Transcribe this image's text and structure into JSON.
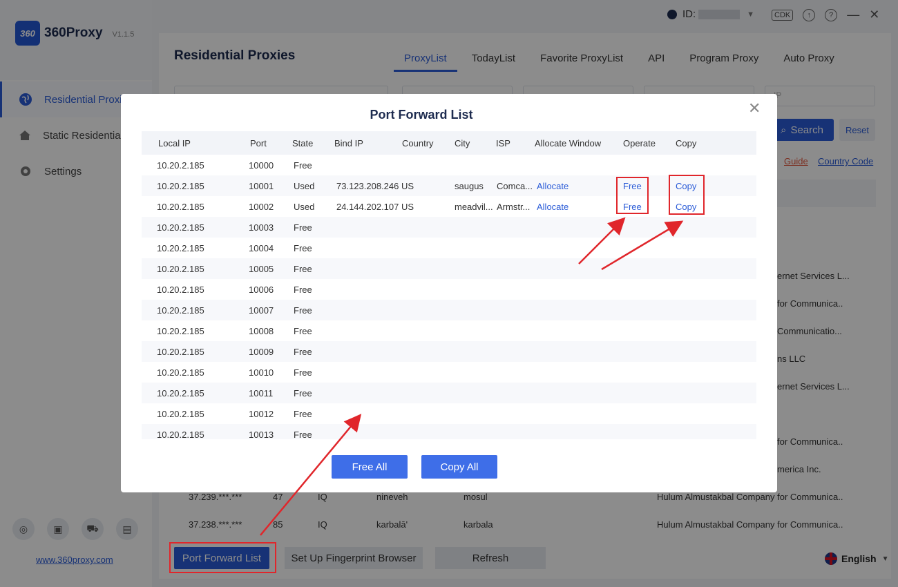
{
  "app": {
    "name": "360Proxy",
    "version": "V1.1.5",
    "logo_text": "360",
    "website": "www.360proxy.com"
  },
  "topbar": {
    "id_label": "ID:",
    "cdk": "CDK"
  },
  "sidebar": {
    "items": [
      {
        "label": "Residential Proxies",
        "icon": "globe-icon"
      },
      {
        "label": "Static Residential Proxies",
        "icon": "home-icon"
      },
      {
        "label": "Settings",
        "icon": "gear-icon"
      }
    ]
  },
  "page": {
    "title": "Residential Proxies"
  },
  "tabs": [
    "ProxyList",
    "TodayList",
    "Favorite ProxyList",
    "API",
    "Program Proxy",
    "Auto Proxy"
  ],
  "filters": {
    "ip_select": "IP",
    "search": "Search",
    "reset": "Reset",
    "guide": "Guide",
    "country_code": "Country Code"
  },
  "background_rows": [
    {
      "isp": "ernet Services L..."
    },
    {
      "isp": "for Communica.."
    },
    {
      "isp": "Communicatio..."
    },
    {
      "isp": "ns LLC"
    },
    {
      "isp": "ernet Services L..."
    },
    {
      "isp": ""
    },
    {
      "isp": "for Communica.."
    },
    {
      "isp": "merica Inc."
    },
    {
      "ip": "37.239.***.***",
      "n": "47",
      "cc": "IQ",
      "region": "nineveh",
      "city": "mosul",
      "isp": "Hulum Almustakbal Company for Communica.."
    },
    {
      "ip": "37.238.***.***",
      "n": "85",
      "cc": "IQ",
      "region": "karbalā'",
      "city": "karbala",
      "isp": "Hulum Almustakbal Company for Communica.."
    }
  ],
  "bottom": {
    "port_forward": "Port Forward List",
    "fingerprint": "Set Up Fingerprint Browser",
    "refresh": "Refresh",
    "language": "English"
  },
  "modal": {
    "title": "Port Forward List",
    "columns": [
      "Local IP",
      "Port",
      "State",
      "Bind IP",
      "Country",
      "City",
      "ISP",
      "Allocate Window",
      "Operate",
      "Copy"
    ],
    "rows": [
      {
        "local_ip": "10.20.2.185",
        "port": "10000",
        "state": "Free",
        "bind_ip": "",
        "country": "",
        "city": "",
        "isp": "",
        "allocate": "",
        "operate": "",
        "copy": ""
      },
      {
        "local_ip": "10.20.2.185",
        "port": "10001",
        "state": "Used",
        "bind_ip": "73.123.208.246",
        "country": "US",
        "city": "saugus",
        "isp": "Comca...",
        "allocate": "Allocate",
        "operate": "Free",
        "copy": "Copy"
      },
      {
        "local_ip": "10.20.2.185",
        "port": "10002",
        "state": "Used",
        "bind_ip": "24.144.202.107",
        "country": "US",
        "city": "meadvil...",
        "isp": "Armstr...",
        "allocate": "Allocate",
        "operate": "Free",
        "copy": "Copy"
      },
      {
        "local_ip": "10.20.2.185",
        "port": "10003",
        "state": "Free"
      },
      {
        "local_ip": "10.20.2.185",
        "port": "10004",
        "state": "Free"
      },
      {
        "local_ip": "10.20.2.185",
        "port": "10005",
        "state": "Free"
      },
      {
        "local_ip": "10.20.2.185",
        "port": "10006",
        "state": "Free"
      },
      {
        "local_ip": "10.20.2.185",
        "port": "10007",
        "state": "Free"
      },
      {
        "local_ip": "10.20.2.185",
        "port": "10008",
        "state": "Free"
      },
      {
        "local_ip": "10.20.2.185",
        "port": "10009",
        "state": "Free"
      },
      {
        "local_ip": "10.20.2.185",
        "port": "10010",
        "state": "Free"
      },
      {
        "local_ip": "10.20.2.185",
        "port": "10011",
        "state": "Free"
      },
      {
        "local_ip": "10.20.2.185",
        "port": "10012",
        "state": "Free"
      },
      {
        "local_ip": "10.20.2.185",
        "port": "10013",
        "state": "Free"
      }
    ],
    "free_all": "Free All",
    "copy_all": "Copy All"
  },
  "colors": {
    "accent": "#2a5bd7",
    "annotation": "#e0262b"
  }
}
